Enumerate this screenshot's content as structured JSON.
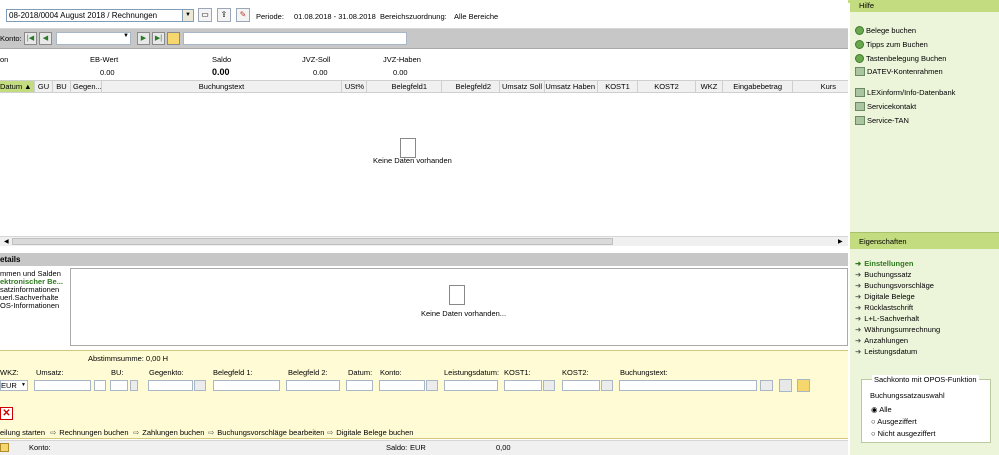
{
  "toolbar": {
    "combo_value": "08-2018/0004   August 2018 / Rechnungen",
    "periode_label": "Periode:",
    "periode_value": "01.08.2018 - 31.08.2018",
    "bereich_label": "Bereichszuordnung:",
    "bereich_value": "Alle Bereiche"
  },
  "nav": {
    "konto_label": "Konto:"
  },
  "summary": {
    "labels": [
      "on",
      "EB-Wert",
      "Saldo",
      "JVZ-Soll",
      "JVZ-Haben"
    ],
    "values": [
      "0.00",
      "0.00",
      "0.00",
      "0.00"
    ]
  },
  "grid": {
    "columns": [
      "Datum",
      "GU",
      "BU",
      "Gegen...",
      "Buchungstext",
      "USt%",
      "Belegfeld1",
      "Belegfeld2",
      "Umsatz Soll",
      "Umsatz Haben",
      "KOST1",
      "KOST2",
      "WKZ",
      "Eingabebetrag",
      "Kurs"
    ],
    "empty_text": "Keine Daten vorhanden"
  },
  "details": {
    "title": "etails",
    "items": [
      "mmen und Salden",
      "ektronischer Be...",
      "satzinformationen",
      "uerl.Sachverhalte",
      "OS-Informationen"
    ],
    "empty_text": "Keine Daten vorhanden..."
  },
  "entry": {
    "abstimm": "Abstimmsumme: 0,00 H",
    "labels": [
      "WKZ:",
      "Umsatz:",
      "BU:",
      "Gegenkto:",
      "Belegfeld 1:",
      "Belegfeld 2:",
      "Datum:",
      "Konto:",
      "Leistungsdatum:",
      "KOST1:",
      "KOST2:",
      "Buchungstext:"
    ],
    "wkz_value": "EUR",
    "links": [
      "eilung starten",
      "Rechnungen buchen",
      "Zahlungen buchen",
      "Buchungsvorschläge bearbeiten",
      "Digitale Belege buchen"
    ]
  },
  "status": {
    "konto_label": "Konto:",
    "saldo_label": "Saldo:",
    "currency": "EUR",
    "saldo_value": "0,00"
  },
  "right_panel": {
    "help_title": "Hilfe",
    "help_items": [
      "Belege buchen",
      "Tipps zum Buchen",
      "Tastenbelegung Buchen",
      "DATEV-Kontenrahmen"
    ],
    "info_items": [
      "LEXinform/Info-Datenbank",
      "Servicekontakt",
      "Service-TAN"
    ],
    "props_title": "Eigenschaften",
    "props_items": [
      "Einstellungen",
      "Buchungssatz",
      "Buchungsvorschläge",
      "Digitale Belege",
      "Rücklastschrift",
      "L+L-Sachverhalt",
      "Währungsumrechnung",
      "Anzahlungen",
      "Leistungsdatum"
    ],
    "opos_group": "Sachkonto mit OPOS-Funktion",
    "opos_label": "Buchungssatzauswahl",
    "opos_options": [
      "Alle",
      "Ausgeziffert",
      "Nicht ausgeziffert"
    ]
  },
  "colors": {
    "accent": "#c3dc7f",
    "entry_bg": "#fffbd5",
    "panel_bg": "#ecf4da"
  }
}
